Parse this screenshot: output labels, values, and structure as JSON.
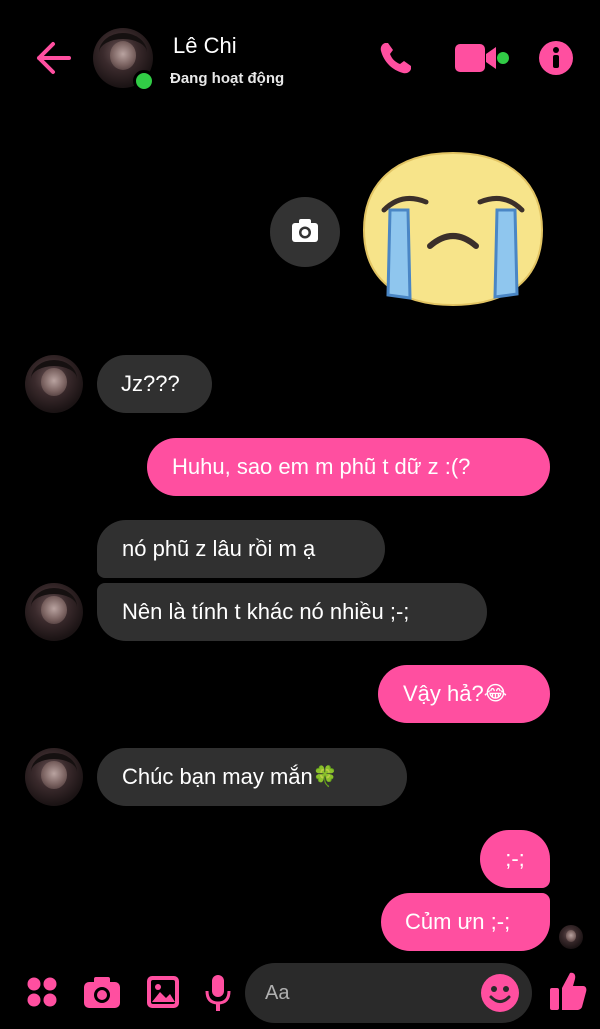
{
  "header": {
    "contact_name": "Lê Chi",
    "status_text": "Đang hoạt động",
    "icons": [
      "back-arrow-icon",
      "phone-icon",
      "video-call-icon",
      "info-icon"
    ],
    "accent_color": "#ff4fa0",
    "online_color": "#31cc46"
  },
  "messages": [
    {
      "direction": "out",
      "type": "sticker",
      "sticker": "crying-face-sticker"
    },
    {
      "direction": "in",
      "text": "Jz???"
    },
    {
      "direction": "out",
      "text": "Huhu, sao em m phũ t dữ z :(?"
    },
    {
      "direction": "in",
      "text": "nó phũ z lâu rồi m ạ"
    },
    {
      "direction": "in",
      "text": "Nên là tính t khác nó nhiều ;-;"
    },
    {
      "direction": "out",
      "text": "Vậy hả?",
      "emoji": "😂"
    },
    {
      "direction": "in",
      "text": "Chúc bạn may mắn",
      "emoji": "🍀"
    },
    {
      "direction": "out",
      "text": ";-;"
    },
    {
      "direction": "out",
      "text": "Củm ưn ;-;"
    }
  ],
  "composer": {
    "placeholder": "Aa",
    "icons": [
      "menu-dots-icon",
      "camera-icon",
      "gallery-icon",
      "microphone-icon",
      "emoji-icon",
      "like-thumb-icon"
    ]
  },
  "colors": {
    "outgoing_bubble": "#ff4fa0",
    "incoming_bubble": "#303030",
    "background": "#000000"
  }
}
